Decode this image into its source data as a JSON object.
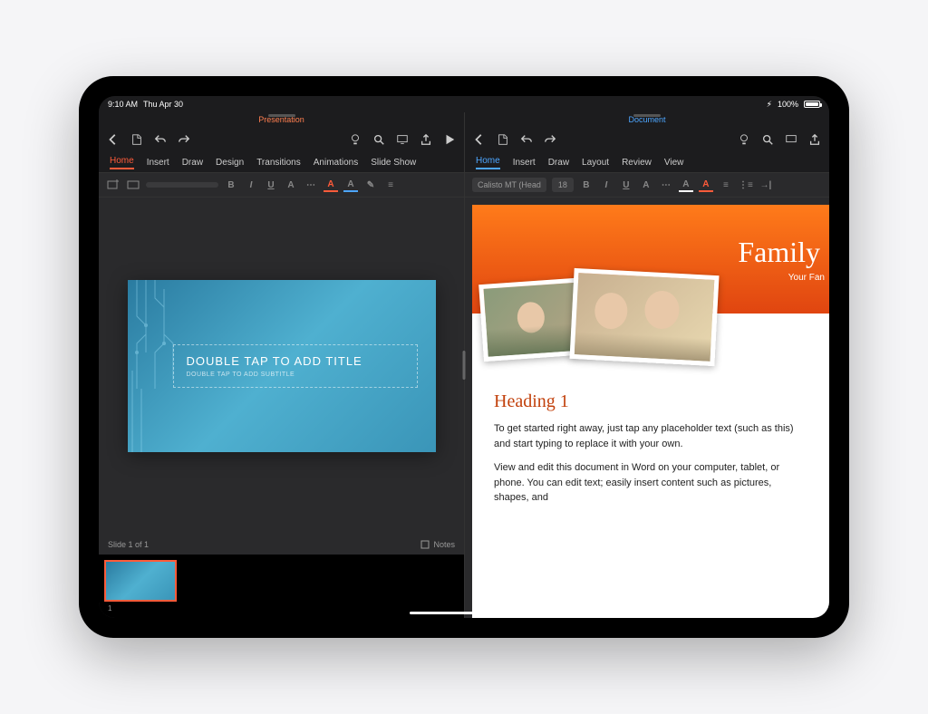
{
  "status": {
    "time": "9:10 AM",
    "date": "Thu Apr 30",
    "battery": "100%",
    "lightning": "⚡︎"
  },
  "leftApp": {
    "title": "Presentation",
    "tabs": [
      "Home",
      "Insert",
      "Draw",
      "Design",
      "Transitions",
      "Animations",
      "Slide Show"
    ],
    "activeTab": 0,
    "format": {
      "bold": "B",
      "italic": "I",
      "underline": "U",
      "strike": "A",
      "fontcolor": "A",
      "highlight": "A"
    },
    "slide": {
      "titlePlaceholder": "DOUBLE TAP TO ADD TITLE",
      "subtitlePlaceholder": "DOUBLE TAP TO ADD SUBTITLE"
    },
    "status": "Slide 1 of 1",
    "notesLabel": "Notes",
    "thumbNum": "1"
  },
  "rightApp": {
    "title": "Document",
    "tabs": [
      "Home",
      "Insert",
      "Draw",
      "Layout",
      "Review",
      "View"
    ],
    "activeTab": 0,
    "format": {
      "font": "Calisto MT (Head",
      "size": "18",
      "bold": "B",
      "italic": "I",
      "underline": "U",
      "strike": "A",
      "fontcolor": "A",
      "highlight": "A"
    },
    "doc": {
      "mainTitle": "Family",
      "subTitle": "Your Fan",
      "heading1": "Heading 1",
      "para1": "To get started right away, just tap any placeholder text (such as this) and start typing to replace it with your own.",
      "para2": "View and edit this document in Word on your computer, tablet, or phone. You can edit text; easily insert content such as pictures, shapes, and"
    }
  }
}
